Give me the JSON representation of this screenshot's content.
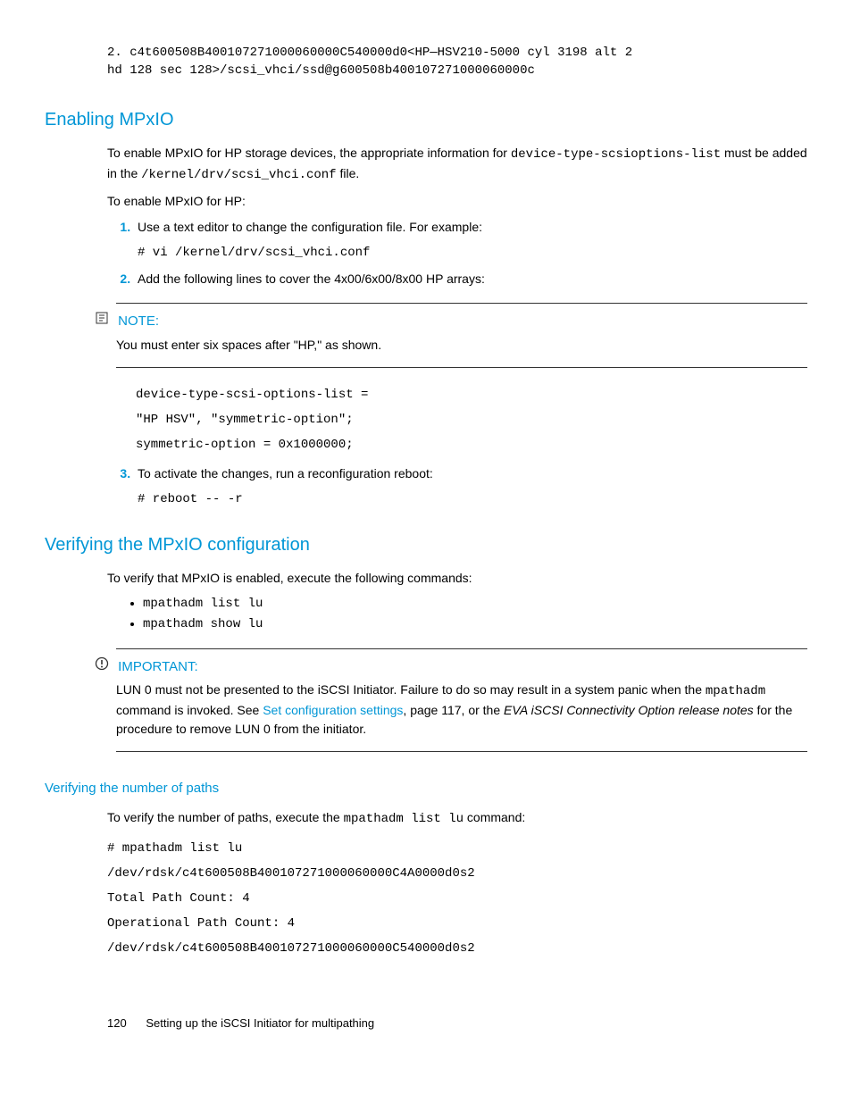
{
  "topcode": {
    "l1": "2. c4t600508B400107271000060000C540000d0<HP—HSV210-5000 cyl 3198 alt 2",
    "l2": "hd 128 sec 128>/scsi_vhci/ssd@g600508b400107271000060000c"
  },
  "h2a": "Enabling MPxIO",
  "para1a": "To enable MPxIO for HP storage devices, the appropriate information for ",
  "para1b": "device-type-scsioptions-list",
  "para1c": " must be added in the ",
  "para1d": "/kernel/drv/scsi_vhci.conf",
  "para1e": " file.",
  "para2": "To enable MPxIO for HP:",
  "step1": "Use a text editor to change the configuration file. For example:",
  "step1code": "# vi /kernel/drv/scsi_vhci.conf",
  "step2": "Add the following lines to cover the 4x00/6x00/8x00 HP arrays:",
  "note_label": "NOTE:",
  "note_body": "You must enter six spaces after \"HP,\" as shown.",
  "cfg1": "device-type-scsi-options-list =",
  "cfg2": "\"HP HSV\", \"symmetric-option\";",
  "cfg3": "symmetric-option = 0x1000000;",
  "step3": "To activate the changes, run a reconfiguration reboot:",
  "step3code": "# reboot -- -r",
  "h2b": "Verifying the MPxIO configuration",
  "verify_intro": "To verify that MPxIO is enabled, execute the following commands:",
  "vb1": "mpathadm list lu",
  "vb2": "mpathadm show lu",
  "imp_label": "IMPORTANT:",
  "imp1": "LUN 0 must not be presented to the iSCSI Initiator. Failure to do so may result in a system panic when the ",
  "imp_mono": "mpathadm",
  "imp2": " command is invoked. See ",
  "imp_link": "Set configuration settings",
  "imp3": ", page 117, or the ",
  "imp_it": "EVA iSCSI Connectivity Option release notes",
  "imp4": " for the procedure to remove LUN 0 from the initiator.",
  "h3": "Verifying the number of paths",
  "paths_intro_a": "To verify the number of paths, execute the ",
  "paths_intro_b": "mpathadm list lu",
  "paths_intro_c": " command:",
  "pc1": "# mpathadm list lu",
  "pc2": "/dev/rdsk/c4t600508B400107271000060000C4A0000d0s2",
  "pc3": "Total Path Count: 4",
  "pc4": "Operational Path Count: 4",
  "pc5": "/dev/rdsk/c4t600508B400107271000060000C540000d0s2",
  "pagenum": "120",
  "footer": "Setting up the iSCSI Initiator for multipathing"
}
